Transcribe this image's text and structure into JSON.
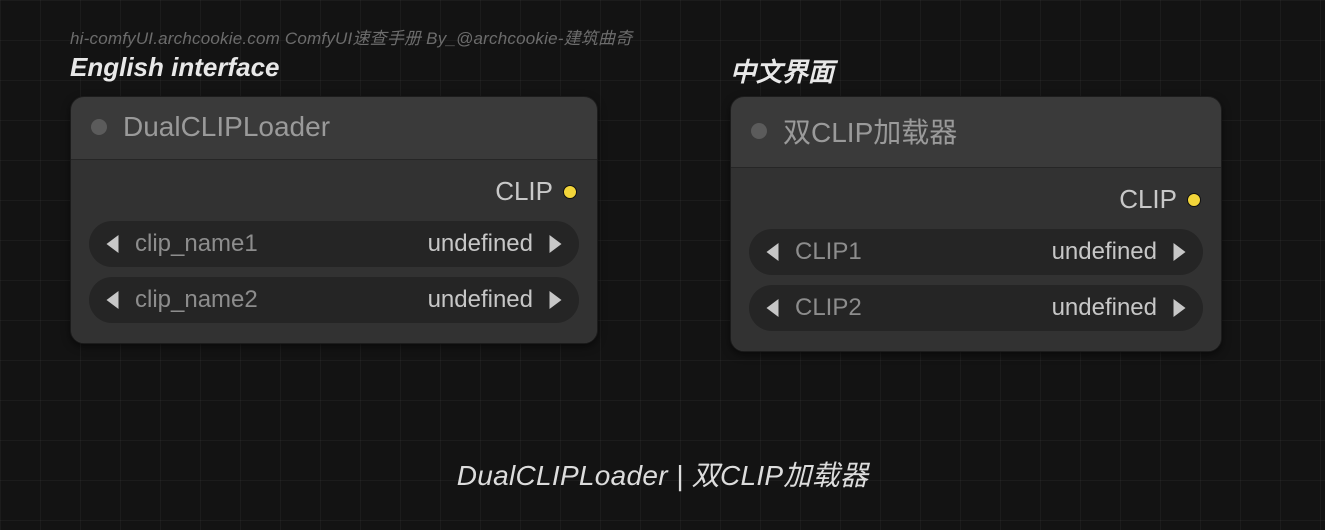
{
  "watermark": "hi-comfyUI.archcookie.com ComfyUI速查手册 By_@archcookie-建筑曲奇",
  "labels": {
    "english_interface": "English interface",
    "chinese_interface": "中文界面"
  },
  "nodes": {
    "english": {
      "title": "DualCLIPLoader",
      "output": "CLIP",
      "widgets": [
        {
          "label": "clip_name1",
          "value": "undefined"
        },
        {
          "label": "clip_name2",
          "value": "undefined"
        }
      ]
    },
    "chinese": {
      "title": "双CLIP加载器",
      "output": "CLIP",
      "widgets": [
        {
          "label": "CLIP1",
          "value": "undefined"
        },
        {
          "label": "CLIP2",
          "value": "undefined"
        }
      ]
    }
  },
  "caption": "DualCLIPLoader | 双CLIP加载器",
  "colors": {
    "output_port": "#f2d53a"
  }
}
